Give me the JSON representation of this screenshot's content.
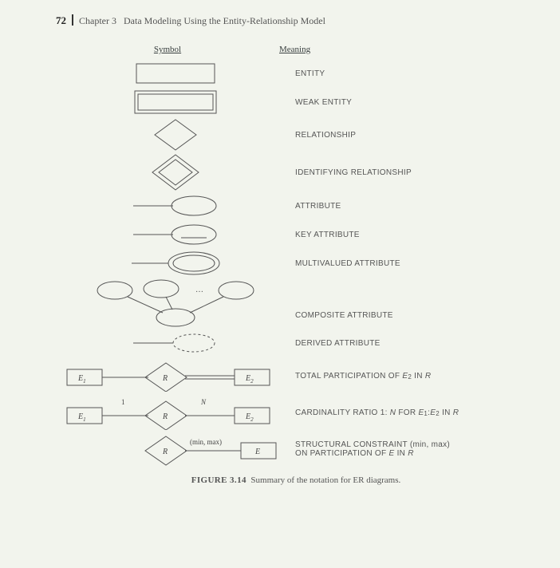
{
  "page": {
    "number": "72",
    "chapter_label": "Chapter 3",
    "chapter_title": "Data Modeling Using the Entity-Relationship Model"
  },
  "columns": {
    "symbol": "Symbol",
    "meaning": "Meaning"
  },
  "rows": {
    "entity": "ENTITY",
    "weak_entity": "WEAK ENTITY",
    "relationship": "RELATIONSHIP",
    "identifying_relationship": "IDENTIFYING RELATIONSHIP",
    "attribute": "ATTRIBUTE",
    "key_attribute": "KEY ATTRIBUTE",
    "multivalued_attribute": "MULTIVALUED ATTRIBUTE",
    "composite_attribute": "COMPOSITE ATTRIBUTE",
    "derived_attribute": "DERIVED ATTRIBUTE",
    "total_participation_prefix": "TOTAL PARTICIPATION OF ",
    "total_participation_entity": "E",
    "total_participation_sub": "2",
    "total_participation_suffix": " IN ",
    "total_participation_rel": "R",
    "cardinality_prefix": "CARDINALITY RATIO 1: ",
    "cardinality_N": "N",
    "cardinality_for": " FOR ",
    "cardinality_e1": "E",
    "cardinality_s1": "1",
    "cardinality_colon": ":",
    "cardinality_e2": "E",
    "cardinality_s2": "2",
    "cardinality_in": " IN ",
    "cardinality_r": "R",
    "structural_line1_a": "STRUCTURAL CONSTRAINT (min, max)",
    "structural_line2_a": "ON PARTICIPATION OF ",
    "structural_e": "E",
    "structural_in": " IN ",
    "structural_r": "R"
  },
  "diagram_labels": {
    "E1": "E",
    "E1_sub": "1",
    "E2": "E",
    "E2_sub": "2",
    "R": "R",
    "one": "1",
    "N": "N",
    "minmax": "(min, max)",
    "E": "E",
    "dots": "…"
  },
  "caption": {
    "figure": "FIGURE 3.14",
    "text": "Summary of the notation for ER diagrams."
  }
}
